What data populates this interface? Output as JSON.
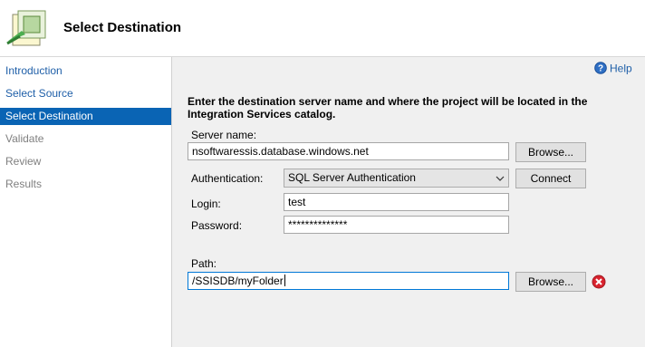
{
  "header": {
    "title": "Select Destination",
    "icon": "wizard-icon"
  },
  "nav": {
    "items": [
      {
        "label": "Introduction",
        "state": "link"
      },
      {
        "label": "Select Source",
        "state": "link"
      },
      {
        "label": "Select Destination",
        "state": "active"
      },
      {
        "label": "Validate",
        "state": "disabled"
      },
      {
        "label": "Review",
        "state": "disabled"
      },
      {
        "label": "Results",
        "state": "disabled"
      }
    ]
  },
  "help": {
    "label": "Help"
  },
  "form": {
    "instruction": "Enter the destination server name and where the project will be located in the Integration Services catalog.",
    "server_label": "Server name:",
    "server_value": "nsoftwaressis.database.windows.net",
    "server_browse": "Browse...",
    "auth_label": "Authentication:",
    "auth_value": "SQL Server Authentication",
    "connect": "Connect",
    "login_label": "Login:",
    "login_value": "test",
    "password_label": "Password:",
    "password_value": "**************",
    "path_label": "Path:",
    "path_value": "/SSISDB/myFolder",
    "path_browse": "Browse..."
  },
  "colors": {
    "accent": "#0a64b4",
    "link": "#1f5fa8",
    "error": "#d9232e"
  }
}
